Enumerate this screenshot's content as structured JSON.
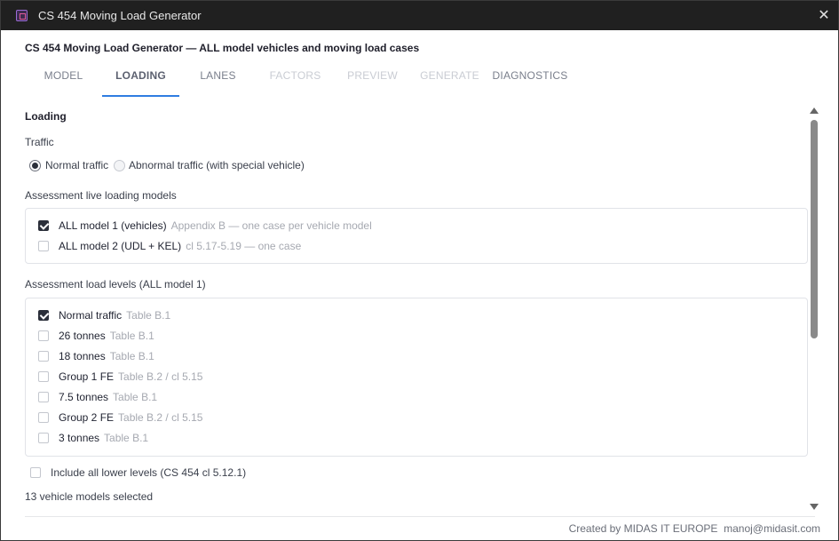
{
  "window": {
    "title": "CS 454 Moving Load Generator",
    "close_glyph": "✕"
  },
  "heading": "CS 454 Moving Load Generator — ALL model vehicles and moving load cases",
  "tabs": [
    {
      "label": "MODEL",
      "state": "normal"
    },
    {
      "label": "LOADING",
      "state": "active"
    },
    {
      "label": "LANES",
      "state": "normal"
    },
    {
      "label": "FACTORS",
      "state": "disabled"
    },
    {
      "label": "PREVIEW",
      "state": "disabled"
    },
    {
      "label": "GENERATE",
      "state": "disabled"
    },
    {
      "label": "DIAGNOSTICS",
      "state": "normal"
    }
  ],
  "loading": {
    "section_title": "Loading",
    "traffic_label": "Traffic",
    "traffic_options": [
      {
        "label": "Normal traffic",
        "selected": true
      },
      {
        "label": "Abnormal traffic (with special vehicle)",
        "selected": false
      }
    ],
    "models_label": "Assessment live loading models",
    "models": [
      {
        "label": "ALL model 1 (vehicles)",
        "ref": "Appendix B — one case per vehicle model",
        "checked": true
      },
      {
        "label": "ALL model 2 (UDL + KEL)",
        "ref": "cl 5.17-5.19 — one case",
        "checked": false
      }
    ],
    "levels_label": "Assessment load levels (ALL model 1)",
    "levels": [
      {
        "label": "Normal traffic",
        "ref": "Table B.1",
        "checked": true
      },
      {
        "label": "26 tonnes",
        "ref": "Table B.1",
        "checked": false
      },
      {
        "label": "18 tonnes",
        "ref": "Table B.1",
        "checked": false
      },
      {
        "label": "Group 1 FE",
        "ref": "Table B.2 / cl 5.15",
        "checked": false
      },
      {
        "label": "7.5 tonnes",
        "ref": "Table B.1",
        "checked": false
      },
      {
        "label": "Group 2 FE",
        "ref": "Table B.2 / cl 5.15",
        "checked": false
      },
      {
        "label": "3 tonnes",
        "ref": "Table B.1",
        "checked": false
      }
    ],
    "include_lower_label": "Include all lower levels (CS 454 cl 5.12.1)",
    "include_lower_checked": false,
    "selected_count_text": "13 vehicle models selected"
  },
  "footer": {
    "credit": "Created by MIDAS IT EUROPE",
    "email": "manoj@midasit.com"
  },
  "icons": {
    "app": "app-icon",
    "close": "close-icon",
    "scroll_up": "scroll-up-arrow-icon",
    "scroll_down": "scroll-down-arrow-icon"
  },
  "colors": {
    "titlebar": "#202020",
    "tab_indicator": "#2f7de1",
    "checked_box": "#2b2f3a",
    "muted_text": "#a6a9b1"
  }
}
